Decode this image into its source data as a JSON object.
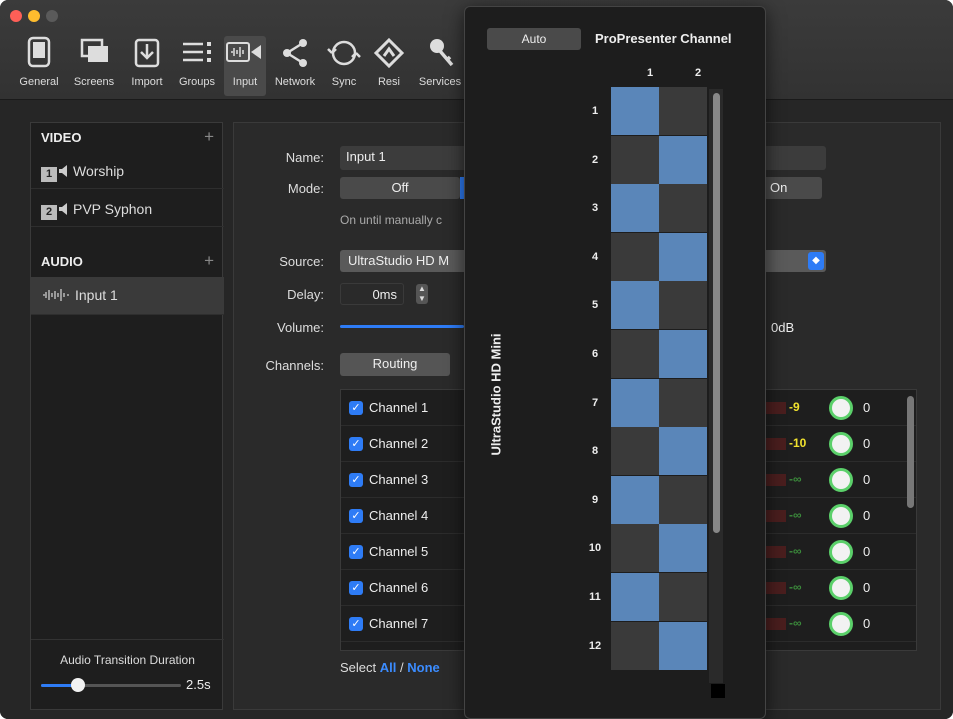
{
  "window": {
    "traffic_lights": [
      "#fe5f57",
      "#febc2e",
      "#5a5a5a"
    ]
  },
  "toolbar": {
    "items": [
      {
        "label": "General",
        "icon": "general-icon"
      },
      {
        "label": "Screens",
        "icon": "screens-icon"
      },
      {
        "label": "Import",
        "icon": "import-icon"
      },
      {
        "label": "Groups",
        "icon": "groups-icon"
      },
      {
        "label": "Input",
        "icon": "input-icon"
      },
      {
        "label": "Network",
        "icon": "network-icon"
      },
      {
        "label": "Sync",
        "icon": "sync-icon"
      },
      {
        "label": "Resi",
        "icon": "resi-icon"
      },
      {
        "label": "Services",
        "icon": "services-icon"
      }
    ],
    "active": "Input"
  },
  "sidebar": {
    "video_header": "VIDEO",
    "video_items": [
      {
        "num": "1",
        "label": "Worship"
      },
      {
        "num": "2",
        "label": "PVP Syphon"
      }
    ],
    "audio_header": "AUDIO",
    "audio_items": [
      {
        "label": "Input 1"
      }
    ],
    "plus": "+",
    "transition_label": "Audio Transition Duration",
    "transition_value": "2.5s",
    "transition_fraction": 0.25
  },
  "detail": {
    "name_label": "Name:",
    "name_value": "Input 1",
    "mode_label": "Mode:",
    "mode_off": "Off",
    "mode_on": "On",
    "mode_hint": "On until manually c",
    "source_label": "Source:",
    "source_value": "UltraStudio HD M",
    "delay_label": "Delay:",
    "delay_value": "0ms",
    "volume_label": "Volume:",
    "volume_value": "0dB",
    "channels_label": "Channels:",
    "routing_label": "Routing",
    "channels": [
      {
        "name": "Channel 1",
        "db": "-9",
        "gain": "0"
      },
      {
        "name": "Channel 2",
        "db": "-10",
        "gain": "0"
      },
      {
        "name": "Channel 3",
        "db": "-∞",
        "gain": "0"
      },
      {
        "name": "Channel 4",
        "db": "-∞",
        "gain": "0"
      },
      {
        "name": "Channel 5",
        "db": "-∞",
        "gain": "0"
      },
      {
        "name": "Channel 6",
        "db": "-∞",
        "gain": "0"
      },
      {
        "name": "Channel 7",
        "db": "-∞",
        "gain": "0"
      }
    ],
    "select_label": "Select",
    "select_all": "All",
    "select_sep": "/",
    "select_none": "None"
  },
  "routing_popover": {
    "auto_label": "Auto",
    "title": "ProPresenter Channel",
    "side_title": "UltraStudio HD Mini",
    "columns": [
      "1",
      "2"
    ],
    "rows": [
      "1",
      "2",
      "3",
      "4",
      "5",
      "6",
      "7",
      "8",
      "9",
      "10",
      "11",
      "12"
    ],
    "active_column_by_row": [
      1,
      2,
      1,
      2,
      1,
      2,
      1,
      2,
      1,
      2,
      1,
      2
    ],
    "colors": {
      "on": "#5a86b9",
      "off": "#3a3a3a"
    }
  }
}
